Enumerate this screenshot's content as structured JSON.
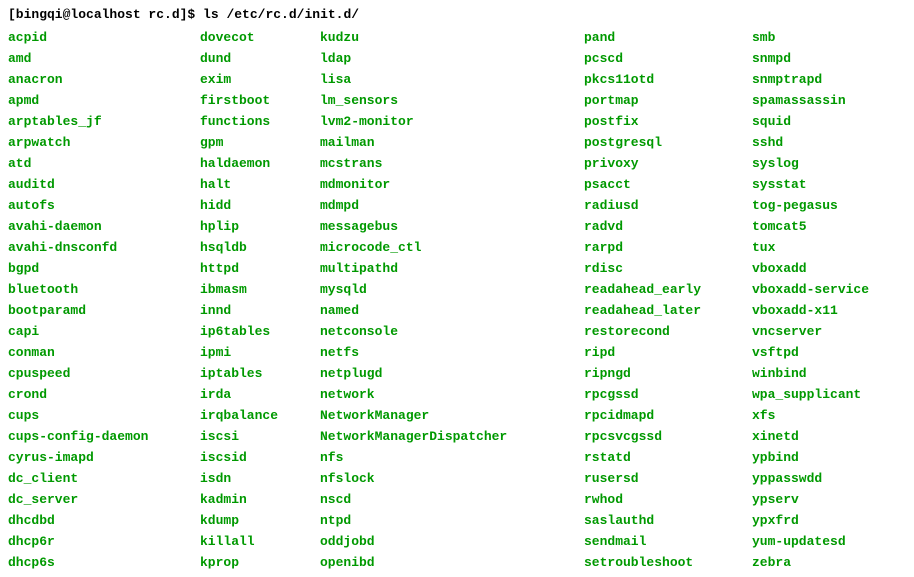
{
  "prompt": {
    "userhost": "[bingqi@localhost rc.d]$",
    "command": "ls /etc/rc.d/init.d/"
  },
  "columns": [
    [
      "acpid",
      "amd",
      "anacron",
      "apmd",
      "arptables_jf",
      "arpwatch",
      "atd",
      "auditd",
      "autofs",
      "avahi-daemon",
      "avahi-dnsconfd",
      "bgpd",
      "bluetooth",
      "bootparamd",
      "capi",
      "conman",
      "cpuspeed",
      "crond",
      "cups",
      "cups-config-daemon",
      "cyrus-imapd",
      "dc_client",
      "dc_server",
      "dhcdbd",
      "dhcp6r",
      "dhcp6s"
    ],
    [
      "dovecot",
      "dund",
      "exim",
      "firstboot",
      "functions",
      "gpm",
      "haldaemon",
      "halt",
      "hidd",
      "hplip",
      "hsqldb",
      "httpd",
      "ibmasm",
      "innd",
      "ip6tables",
      "ipmi",
      "iptables",
      "irda",
      "irqbalance",
      "iscsi",
      "iscsid",
      "isdn",
      "kadmin",
      "kdump",
      "killall",
      "kprop"
    ],
    [
      "kudzu",
      "ldap",
      "lisa",
      "lm_sensors",
      "lvm2-monitor",
      "mailman",
      "mcstrans",
      "mdmonitor",
      "mdmpd",
      "messagebus",
      "microcode_ctl",
      "multipathd",
      "mysqld",
      "named",
      "netconsole",
      "netfs",
      "netplugd",
      "network",
      "NetworkManager",
      "NetworkManagerDispatcher",
      "nfs",
      "nfslock",
      "nscd",
      "ntpd",
      "oddjobd",
      "openibd"
    ],
    [
      "pand",
      "pcscd",
      "pkcs11otd",
      "portmap",
      "postfix",
      "postgresql",
      "privoxy",
      "psacct",
      "radiusd",
      "radvd",
      "rarpd",
      "rdisc",
      "readahead_early",
      "readahead_later",
      "restorecond",
      "ripd",
      "ripngd",
      "rpcgssd",
      "rpcidmapd",
      "rpcsvcgssd",
      "rstatd",
      "rusersd",
      "rwhod",
      "saslauthd",
      "sendmail",
      "setroubleshoot"
    ],
    [
      "smb",
      "snmpd",
      "snmptrapd",
      "spamassassin",
      "squid",
      "sshd",
      "syslog",
      "sysstat",
      "tog-pegasus",
      "tomcat5",
      "tux",
      "vboxadd",
      "vboxadd-service",
      "vboxadd-x11",
      "vncserver",
      "vsftpd",
      "winbind",
      "wpa_supplicant",
      "xfs",
      "xinetd",
      "ypbind",
      "yppasswdd",
      "ypserv",
      "ypxfrd",
      "yum-updatesd",
      "zebra"
    ]
  ]
}
